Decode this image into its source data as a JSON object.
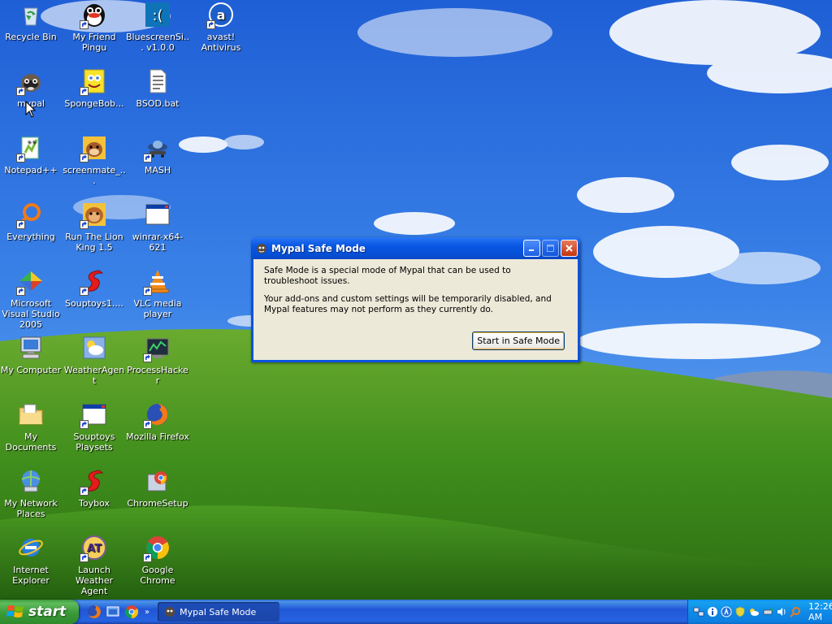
{
  "desktop": {
    "icons": [
      {
        "label": "Recycle Bin",
        "icon": "recycle-bin-icon"
      },
      {
        "label": "My Friend Pingu",
        "icon": "pingu-icon"
      },
      {
        "label": "BluescreenSi... v1.0.0",
        "icon": "bluescreen-icon"
      },
      {
        "label": "avast! Antivirus",
        "icon": "avast-icon"
      },
      {
        "label": "mypal",
        "icon": "mypal-icon"
      },
      {
        "label": "SpongeBob...",
        "icon": "spongebob-icon"
      },
      {
        "label": "BSOD.bat",
        "icon": "batch-file-icon"
      },
      {
        "label": "Notepad++",
        "icon": "notepad-plus-plus-icon"
      },
      {
        "label": "screenmate_...",
        "icon": "screenmate-icon"
      },
      {
        "label": "MASH",
        "icon": "mash-icon"
      },
      {
        "label": "Everything",
        "icon": "everything-search-icon"
      },
      {
        "label": "Run The Lion King 1.5",
        "icon": "lion-king-icon"
      },
      {
        "label": "winrar-x64-621",
        "icon": "window-app-icon"
      },
      {
        "label": "Microsoft Visual Studio 2005",
        "icon": "visual-studio-icon"
      },
      {
        "label": "Souptoys1....",
        "icon": "souptoys-icon"
      },
      {
        "label": "VLC media player",
        "icon": "vlc-icon"
      },
      {
        "label": "My Computer",
        "icon": "my-computer-icon"
      },
      {
        "label": "WeatherAgent",
        "icon": "weather-agent-icon"
      },
      {
        "label": "ProcessHacker",
        "icon": "process-hacker-icon"
      },
      {
        "label": "My Documents",
        "icon": "my-documents-icon"
      },
      {
        "label": "Souptoys Playsets",
        "icon": "window-app-icon"
      },
      {
        "label": "Mozilla Firefox",
        "icon": "firefox-icon"
      },
      {
        "label": "My Network Places",
        "icon": "network-places-icon"
      },
      {
        "label": "Toybox",
        "icon": "toybox-icon"
      },
      {
        "label": "ChromeSetup",
        "icon": "chrome-setup-icon"
      },
      {
        "label": "Internet Explorer",
        "icon": "internet-explorer-icon"
      },
      {
        "label": "Launch Weather Agent",
        "icon": "weather-agent-launch-icon"
      },
      {
        "label": "Google Chrome",
        "icon": "chrome-icon"
      }
    ]
  },
  "dialog": {
    "title": "Mypal Safe Mode",
    "paragraph1": "Safe Mode is a special mode of Mypal that can be used to troubleshoot issues.",
    "paragraph2": "Your add-ons and custom settings will be temporarily disabled, and Mypal features may not perform as they currently do.",
    "button_label": "Start in Safe Mode"
  },
  "taskbar": {
    "start_label": "start",
    "task_button_label": "Mypal Safe Mode",
    "quick_launch_more": "»",
    "clock": "12:26 AM"
  },
  "colors": {
    "taskbar_blue": "#245edb",
    "start_green": "#3c9c3d",
    "dialog_title_blue": "#0856e3",
    "dialog_body": "#ece9d8"
  }
}
